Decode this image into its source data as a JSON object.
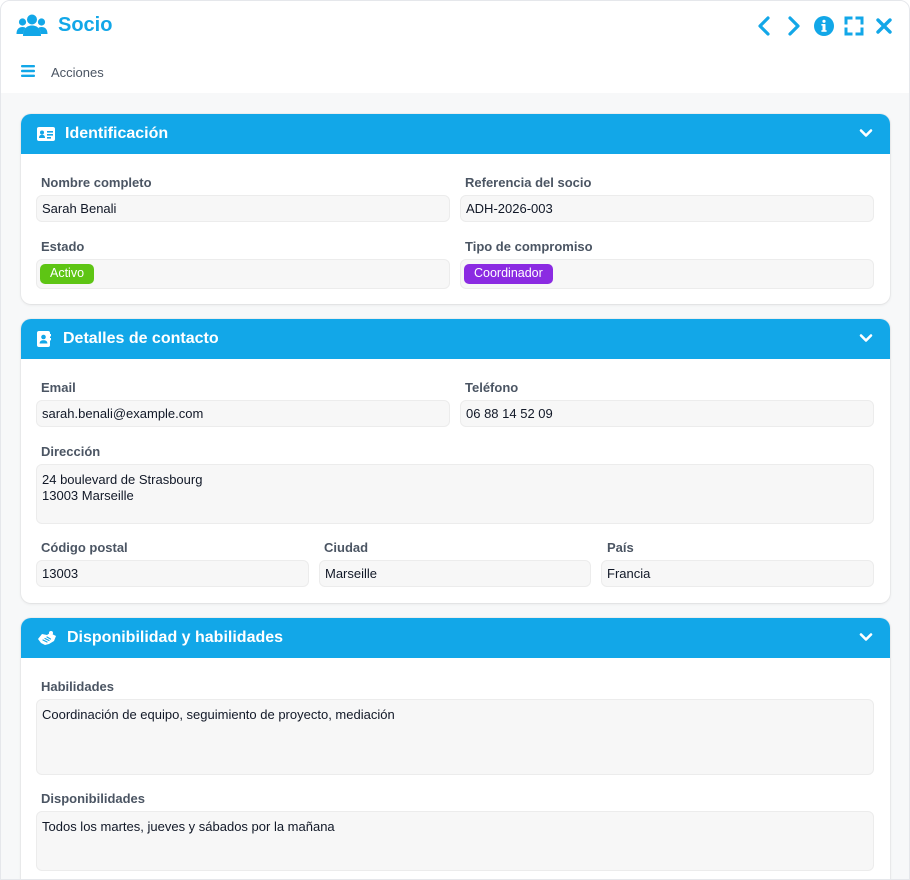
{
  "app": {
    "title": "Socio",
    "accent_color": "#12a7e8",
    "icons": [
      "users-icon",
      "chevron-left-icon",
      "chevron-right-icon",
      "info-icon",
      "expand-icon",
      "close-icon",
      "menu-icon"
    ]
  },
  "toolbar": {
    "actions_label": "Acciones"
  },
  "sections": {
    "identificacion": {
      "title": "Identificación",
      "icon": "id-card-icon",
      "fields": {
        "nombre": {
          "label": "Nombre completo",
          "value": "Sarah Benali"
        },
        "referencia": {
          "label": "Referencia del socio",
          "value": "ADH-2026-003"
        },
        "estado": {
          "label": "Estado",
          "value": "Activo",
          "color": "#5ec514"
        },
        "tipo": {
          "label": "Tipo de compromiso",
          "value": "Coordinador",
          "color": "#8b2be2"
        }
      }
    },
    "contacto": {
      "title": "Detalles de contacto",
      "icon": "address-book-icon",
      "fields": {
        "email": {
          "label": "Email",
          "value": "sarah.benali@example.com"
        },
        "telefono": {
          "label": "Teléfono",
          "value": "06 88 14 52 09"
        },
        "direccion": {
          "label": "Dirección",
          "value": "24 boulevard de Strasbourg\n13003 Marseille"
        },
        "cp": {
          "label": "Código postal",
          "value": "13003"
        },
        "ciudad": {
          "label": "Ciudad",
          "value": "Marseille"
        },
        "pais": {
          "label": "País",
          "value": "Francia"
        }
      }
    },
    "disponibilidad": {
      "title": "Disponibilidad y habilidades",
      "icon": "handshake-icon",
      "fields": {
        "habilidades": {
          "label": "Habilidades",
          "value": "Coordinación de equipo, seguimiento de proyecto, mediación"
        },
        "disponibilidades": {
          "label": "Disponibilidades",
          "value": "Todos los martes, jueves y sábados por la mañana"
        }
      }
    }
  }
}
